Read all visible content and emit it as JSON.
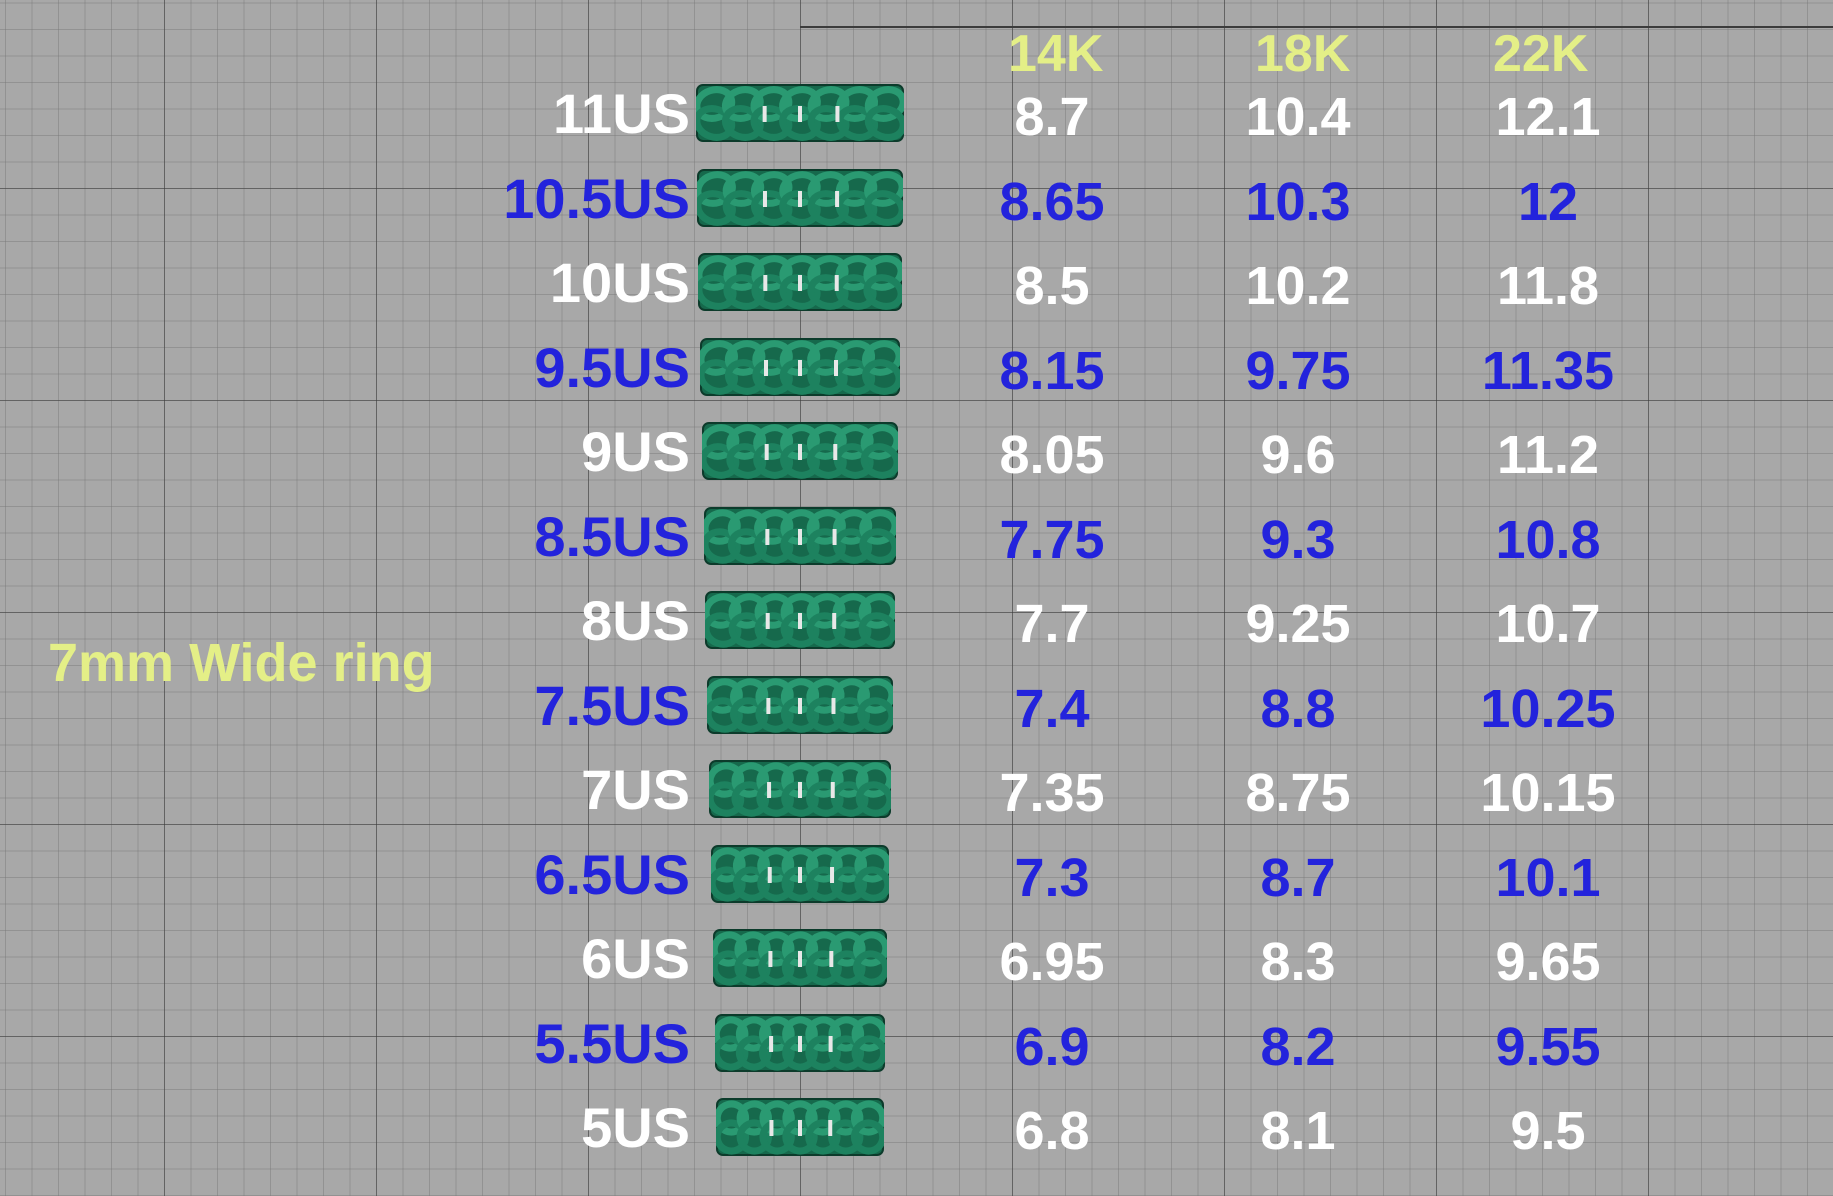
{
  "title": "7mm Wide ring",
  "headers": [
    "14K",
    "18K",
    "22K"
  ],
  "colors": {
    "background": "#a8a8a8",
    "header_text": "#e4ef87",
    "white_row_text": "#ffffff",
    "blue_row_text": "#2323dc",
    "ring_green": "#1f7a5a"
  },
  "icons": {
    "ring": "cuban-link-ring-render-icon"
  },
  "rows": [
    {
      "size": "11US",
      "k14": "8.7",
      "k18": "10.4",
      "k22": "12.1",
      "style": "white"
    },
    {
      "size": "10.5US",
      "k14": "8.65",
      "k18": "10.3",
      "k22": "12",
      "style": "blue"
    },
    {
      "size": "10US",
      "k14": "8.5",
      "k18": "10.2",
      "k22": "11.8",
      "style": "white"
    },
    {
      "size": "9.5US",
      "k14": "8.15",
      "k18": "9.75",
      "k22": "11.35",
      "style": "blue"
    },
    {
      "size": "9US",
      "k14": "8.05",
      "k18": "9.6",
      "k22": "11.2",
      "style": "white"
    },
    {
      "size": "8.5US",
      "k14": "7.75",
      "k18": "9.3",
      "k22": "10.8",
      "style": "blue"
    },
    {
      "size": "8US",
      "k14": "7.7",
      "k18": "9.25",
      "k22": "10.7",
      "style": "white"
    },
    {
      "size": "7.5US",
      "k14": "7.4",
      "k18": "8.8",
      "k22": "10.25",
      "style": "blue"
    },
    {
      "size": "7US",
      "k14": "7.35",
      "k18": "8.75",
      "k22": "10.15",
      "style": "white"
    },
    {
      "size": "6.5US",
      "k14": "7.3",
      "k18": "8.7",
      "k22": "10.1",
      "style": "blue"
    },
    {
      "size": "6US",
      "k14": "6.95",
      "k18": "8.3",
      "k22": "9.65",
      "style": "white"
    },
    {
      "size": "5.5US",
      "k14": "6.9",
      "k18": "8.2",
      "k22": "9.55",
      "style": "blue"
    },
    {
      "size": "5US",
      "k14": "6.8",
      "k18": "8.1",
      "k22": "9.5",
      "style": "white"
    }
  ]
}
